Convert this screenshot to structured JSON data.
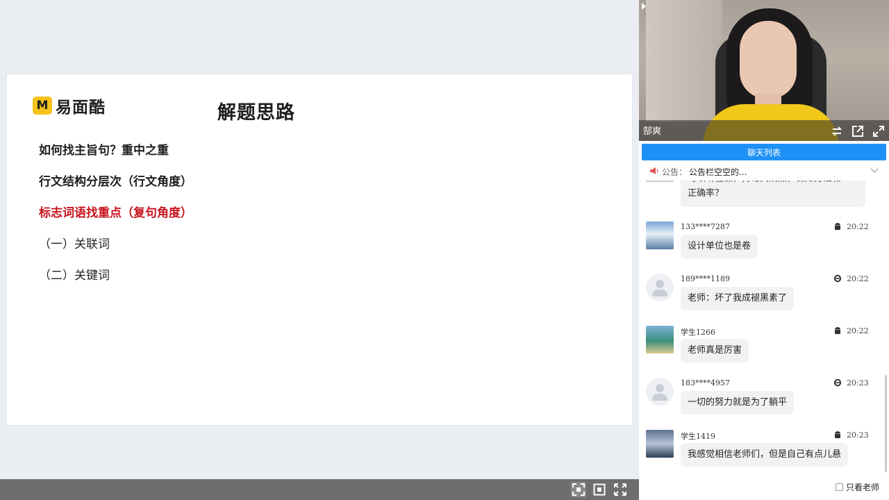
{
  "slide": {
    "logo_mark": "M",
    "logo_text": "易面酷",
    "title": "解题思路",
    "outline": [
      {
        "text": "如何找主旨句？重中之重",
        "style": "bold"
      },
      {
        "text": "行文结构分层次（行文角度）",
        "style": "bold"
      },
      {
        "text": "标志词语找重点（复句角度）",
        "style": "bold-red"
      },
      {
        "text": "（一）关联词",
        "style": "normal"
      },
      {
        "text": "（二）关键词",
        "style": "normal"
      }
    ]
  },
  "video": {
    "teacher_name": "郜爽"
  },
  "chat": {
    "tab_label": "聊天列表",
    "notice_label": "公告：",
    "notice_text": "公告栏空空的...",
    "partial_message": {
      "line1": "可以听懂课，持每大刷点，保障方法和",
      "line2": "正确率？"
    },
    "messages": [
      {
        "sender": "133****7287",
        "time": "20:22",
        "text": "设计单位也是卷",
        "platform": "android-icon",
        "avatar": "image"
      },
      {
        "sender": "189****1189",
        "time": "20:22",
        "text": "老师：坏了我成褪黑素了",
        "platform": "ie-icon",
        "avatar": "default"
      },
      {
        "sender": "学生1266",
        "time": "20:22",
        "text": "老师真是厉害",
        "platform": "android-icon",
        "avatar": "image"
      },
      {
        "sender": "183****4957",
        "time": "20:23",
        "text": "一切的努力就是为了躺平",
        "platform": "ie-icon",
        "avatar": "default"
      },
      {
        "sender": "学生1419",
        "time": "20:23",
        "text": "我感觉相信老师们，但是自己有点儿悬",
        "platform": "android-icon",
        "avatar": "image"
      }
    ],
    "teacher_only_label": "只看老师"
  },
  "toolbar": {
    "buttons": [
      "fit-screen-icon",
      "screenshot-icon",
      "fullscreen-icon"
    ]
  },
  "colors": {
    "accent_blue": "#1e90f6",
    "emphasis_red": "#c8141e",
    "logo_yellow": "#f6c21c"
  }
}
